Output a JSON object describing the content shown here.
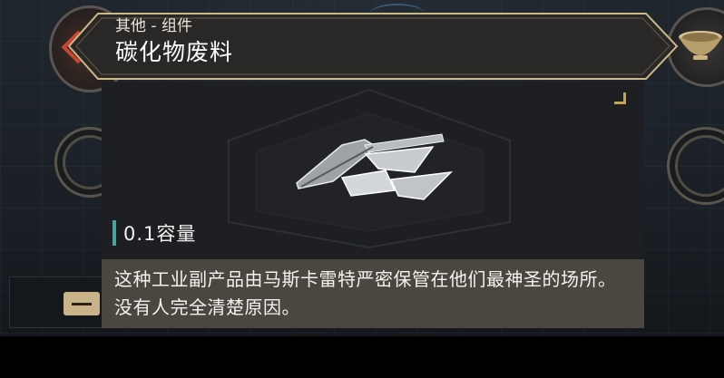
{
  "tooltip": {
    "category": "其他 - 组件",
    "title": "碳化物废料",
    "capacity": "0.1容量",
    "description": "这种工业副产品由马斯卡雷特严密保管在他们最神圣的场所。没有人完全清楚原因。"
  },
  "icons": {
    "back": "back-chevron-icon",
    "bowl": "bowl-icon",
    "item": "carbide-scrap-icon",
    "corner": "corner-marker-icon"
  },
  "colors": {
    "back_accent": "#c9452f",
    "capacity_accent": "#4aa39a",
    "description_bg": "#4a4740",
    "card_bg": "#1d1f22",
    "header_bg": "#2a2826"
  }
}
